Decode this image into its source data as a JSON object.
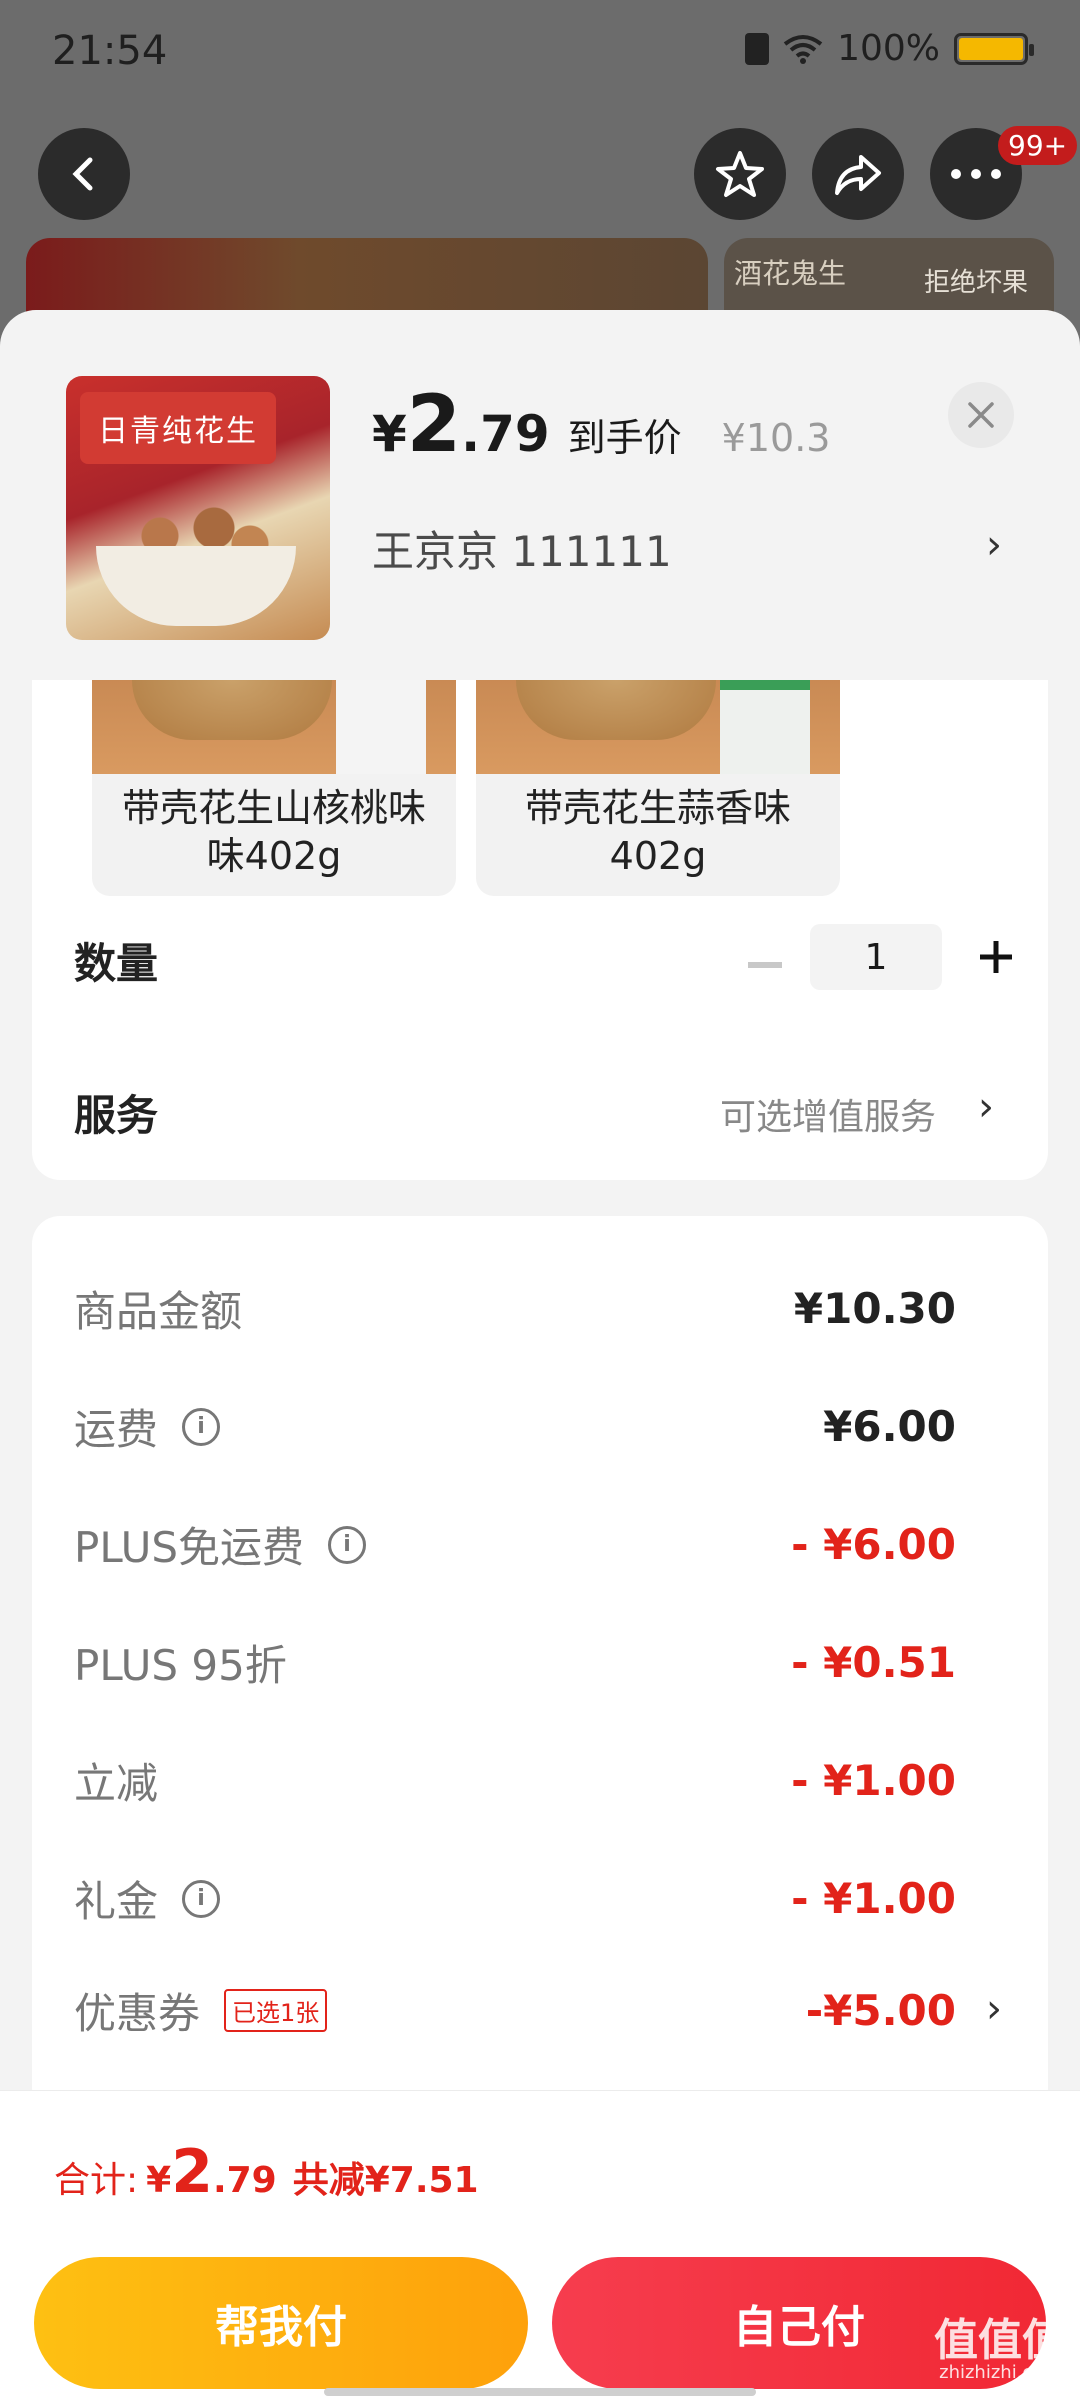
{
  "status": {
    "time": "21:54",
    "battery": "100%"
  },
  "top_actions": {
    "badge": "99+"
  },
  "bg_thumbs": {
    "t1": "酒花鬼生",
    "t2": "拒绝坏果"
  },
  "product": {
    "image_label": "日青纯花生",
    "price_currency": "¥",
    "price_int": "2",
    "price_dec": ".79",
    "price_label": "到手价",
    "original_price": "¥10.3",
    "address": "王京京  111111"
  },
  "variants": [
    {
      "name": "带壳花生山核桃味味402g"
    },
    {
      "name": "带壳花生蒜香味402g"
    }
  ],
  "quantity": {
    "label": "数量",
    "value": "1"
  },
  "service": {
    "label": "服务",
    "value": "可选增值服务"
  },
  "fees": [
    {
      "label": "商品金额",
      "value": "¥10.30",
      "info": false,
      "red": false
    },
    {
      "label": "运费",
      "value": "¥6.00",
      "info": true,
      "red": false
    },
    {
      "label": "PLUS免运费",
      "value": "- ¥6.00",
      "info": true,
      "red": true
    },
    {
      "label": "PLUS 95折",
      "value": "- ¥0.51",
      "info": false,
      "red": true
    },
    {
      "label": "立减",
      "value": "- ¥1.00",
      "info": false,
      "red": true
    },
    {
      "label": "礼金",
      "value": "- ¥1.00",
      "info": true,
      "red": true
    },
    {
      "label": "优惠券",
      "tag": "已选1张",
      "value": "-¥5.00",
      "info": false,
      "red": true
    }
  ],
  "footer": {
    "total_label": "合计:",
    "total_currency": "¥",
    "total_int": "2",
    "total_dec": ".79",
    "saving": "共减¥7.51",
    "btn_help": "帮我付",
    "btn_self": "自己付"
  },
  "watermark": {
    "main": "值值值",
    "sub": "zhizhizhi.com"
  },
  "colors": {
    "red": "#e2231a",
    "yellow": "#fea10b",
    "pay_red": "#f12834"
  }
}
